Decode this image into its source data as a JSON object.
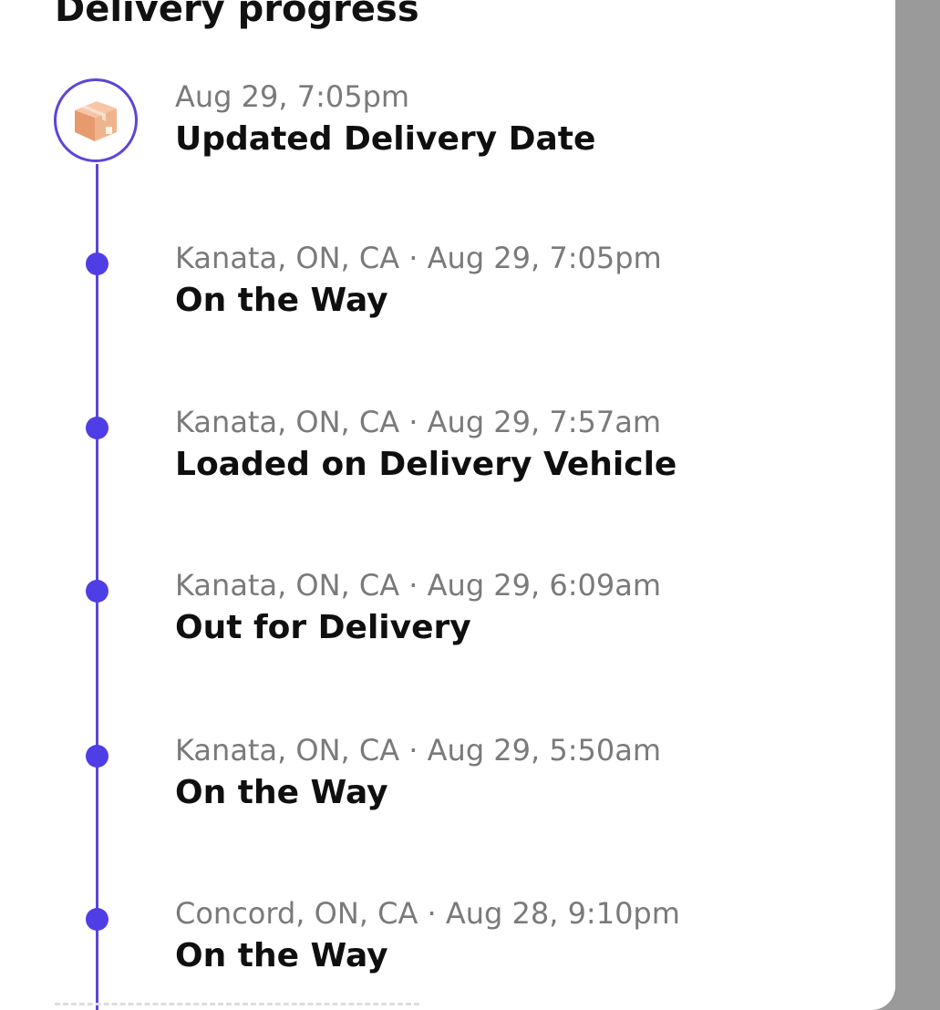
{
  "header": {
    "title": "Delivery progress"
  },
  "colors": {
    "accent": "#5b46d8",
    "dot": "#4f3de6",
    "meta_text": "#7a7a7a",
    "status_text": "#0f0f0f",
    "backdrop": "#9a9a9a"
  },
  "events": [
    {
      "meta": "Aug 29, 7:05pm",
      "status": "Updated Delivery Date",
      "icon": "package-icon"
    },
    {
      "meta": "Kanata, ON, CA · Aug 29, 7:05pm",
      "status": "On the Way"
    },
    {
      "meta": "Kanata, ON, CA · Aug 29, 7:57am",
      "status": "Loaded on Delivery Vehicle"
    },
    {
      "meta": "Kanata, ON, CA · Aug 29, 6:09am",
      "status": "Out for Delivery"
    },
    {
      "meta": "Kanata, ON, CA · Aug 29, 5:50am",
      "status": "On the Way"
    },
    {
      "meta": "Concord, ON, CA · Aug 28, 9:10pm",
      "status": "On the Way"
    }
  ]
}
